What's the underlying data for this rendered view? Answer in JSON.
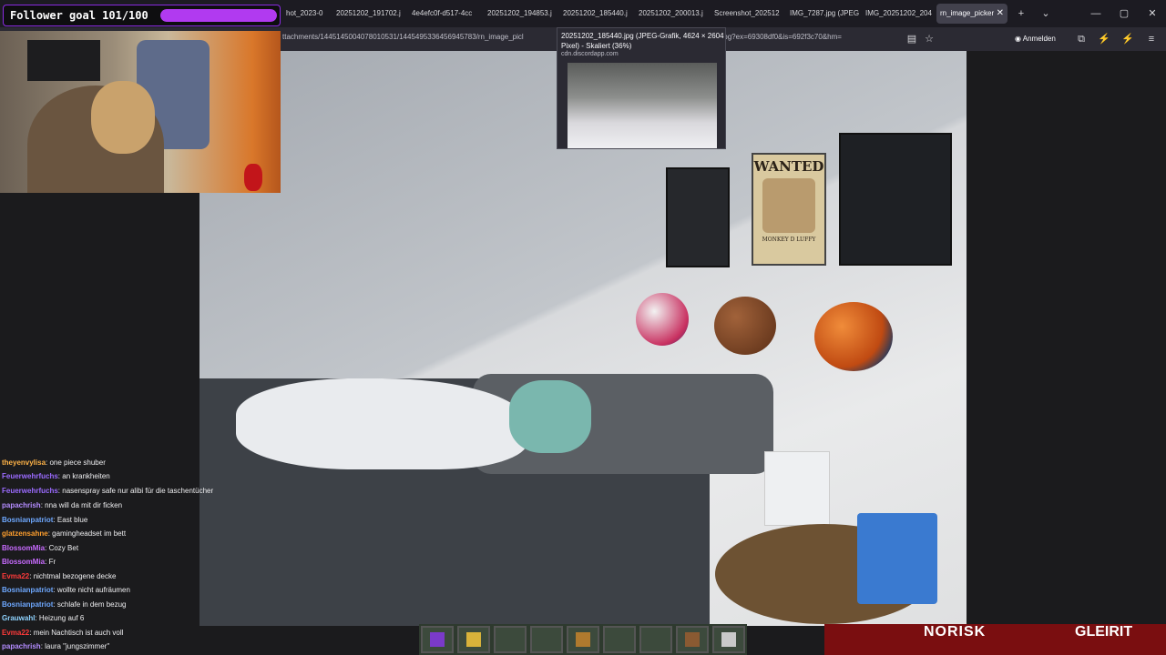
{
  "goal": {
    "text": "Follower goal 101/100",
    "progress": 1.0,
    "fill_color": "#b13af0"
  },
  "tabs": [
    {
      "label": "hot_2023-0"
    },
    {
      "label": "20251202_191702.j"
    },
    {
      "label": "4e4efc0f-d517-4cc"
    },
    {
      "label": "20251202_194853.j"
    },
    {
      "label": "20251202_185440.j"
    },
    {
      "label": "20251202_200013.j"
    },
    {
      "label": "Screenshot_202512"
    },
    {
      "label": "IMG_7287.jpg (JPEG"
    },
    {
      "label": "IMG_20251202_204"
    },
    {
      "label": "rn_image_picker",
      "close": "✕"
    }
  ],
  "window_controls": {
    "new_tab": "+",
    "list": "⌄",
    "minimize": "—",
    "maximize": "▢",
    "close": "✕"
  },
  "urlbar": {
    "url_left": "ttachments/1445145004078010531/1445495336456945783/rn_image_picl",
    "url_right": "052063b.jpg?ex=69308df0&is=692f3c70&hm=",
    "sign_in": "Anmelden"
  },
  "tooltip": {
    "title": "20251202_185440.jpg (JPEG-Grafik, 4624 × 2604 Pixel) - Skaliert (36%)",
    "host": "cdn.discordapp.com"
  },
  "chat": [
    {
      "user": "theyenvylisa",
      "color": "#ffb347",
      "text": "one piece shuber"
    },
    {
      "user": "Feuerwehrfuchs",
      "color": "#9b6bff",
      "text": "an krankheiten"
    },
    {
      "user": "Feuerwehrfuchs",
      "color": "#9b6bff",
      "text": "nasenspray safe nur alibi für die taschentücher"
    },
    {
      "user": "papachrish",
      "color": "#b48cff",
      "text": "nna will da mit dir ficken"
    },
    {
      "user": "Bosnianpatriot",
      "color": "#6ea8ff",
      "text": "East blue"
    },
    {
      "user": "glatzensahne",
      "color": "#ff9f2e",
      "text": "gamingheadset im bett"
    },
    {
      "user": "BlossomMia",
      "color": "#c86bff",
      "text": "Cozy Bet"
    },
    {
      "user": "BlossomMia",
      "color": "#c86bff",
      "text": "Fr"
    },
    {
      "user": "Evma22",
      "color": "#ff3a3a",
      "text": "nichtmal bezogene decke"
    },
    {
      "user": "Bosnianpatriot",
      "color": "#6ea8ff",
      "text": "wollte nicht aufräumen"
    },
    {
      "user": "Bosnianpatriot",
      "color": "#6ea8ff",
      "text": "schlafe in dem bezug"
    },
    {
      "user": "Grauwahl",
      "color": "#8fd3ff",
      "text": "Heizung auf 6"
    },
    {
      "user": "Evma22",
      "color": "#ff3a3a",
      "text": "mein Nachtisch ist auch voll"
    },
    {
      "user": "papachrish",
      "color": "#b48cff",
      "text": "laura \"jungszimmer\""
    }
  ],
  "poster": {
    "title": "WANTED",
    "name": "MONKEY D LUFFY"
  },
  "brand": {
    "left": "NORISK",
    "right": "GLEIRIT"
  }
}
